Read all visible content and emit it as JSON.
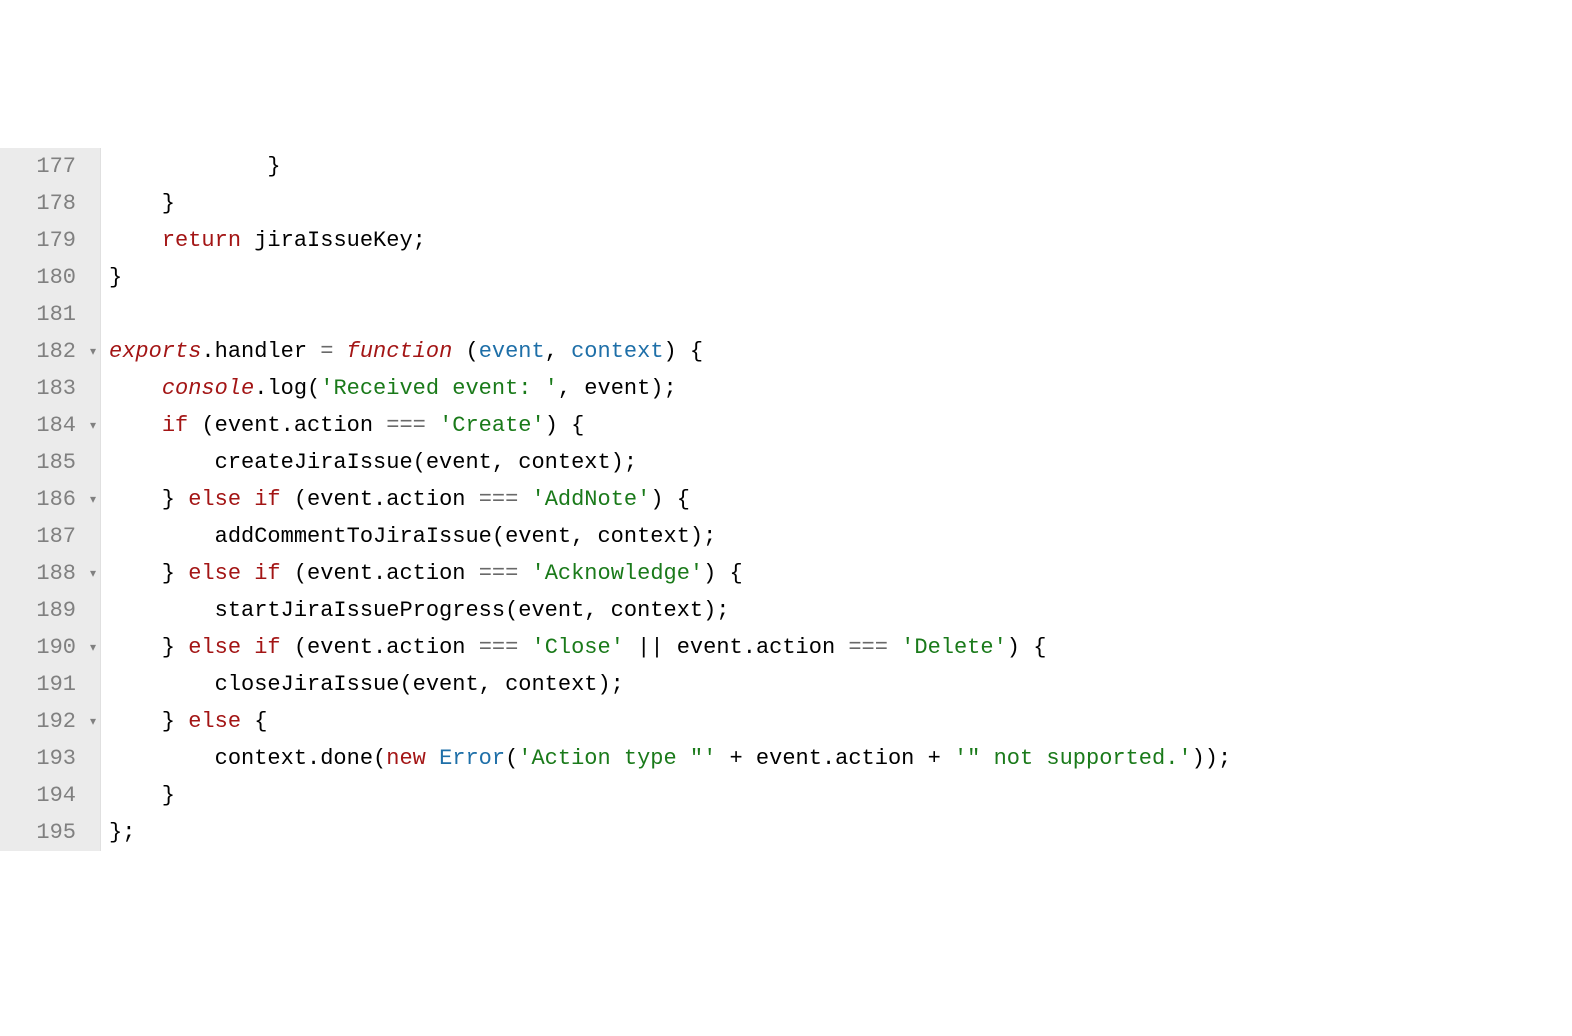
{
  "lines": [
    {
      "num": "177",
      "fold": false,
      "tokens": [
        {
          "cls": "ident",
          "t": "            }"
        }
      ]
    },
    {
      "num": "178",
      "fold": false,
      "tokens": [
        {
          "cls": "ident",
          "t": "    }"
        }
      ]
    },
    {
      "num": "179",
      "fold": false,
      "tokens": [
        {
          "cls": "ident",
          "t": "    "
        },
        {
          "cls": "kw-return",
          "t": "return"
        },
        {
          "cls": "ident",
          "t": " jiraIssueKey;"
        }
      ]
    },
    {
      "num": "180",
      "fold": false,
      "tokens": [
        {
          "cls": "ident",
          "t": "}"
        }
      ]
    },
    {
      "num": "181",
      "fold": false,
      "tokens": []
    },
    {
      "num": "182",
      "fold": true,
      "tokens": [
        {
          "cls": "kw-exports",
          "t": "exports"
        },
        {
          "cls": "ident",
          "t": ".handler "
        },
        {
          "cls": "op",
          "t": "="
        },
        {
          "cls": "ident",
          "t": " "
        },
        {
          "cls": "kw-function",
          "t": "function"
        },
        {
          "cls": "ident",
          "t": " ("
        },
        {
          "cls": "param",
          "t": "event"
        },
        {
          "cls": "ident",
          "t": ", "
        },
        {
          "cls": "param",
          "t": "context"
        },
        {
          "cls": "ident",
          "t": ") {"
        }
      ]
    },
    {
      "num": "183",
      "fold": false,
      "tokens": [
        {
          "cls": "ident",
          "t": "    "
        },
        {
          "cls": "console",
          "t": "console"
        },
        {
          "cls": "ident",
          "t": ".log("
        },
        {
          "cls": "str",
          "t": "'Received event: '"
        },
        {
          "cls": "ident",
          "t": ", event);"
        }
      ]
    },
    {
      "num": "184",
      "fold": true,
      "tokens": [
        {
          "cls": "ident",
          "t": "    "
        },
        {
          "cls": "kw-if",
          "t": "if"
        },
        {
          "cls": "ident",
          "t": " (event.action "
        },
        {
          "cls": "op",
          "t": "==="
        },
        {
          "cls": "ident",
          "t": " "
        },
        {
          "cls": "str",
          "t": "'Create'"
        },
        {
          "cls": "ident",
          "t": ") {"
        }
      ]
    },
    {
      "num": "185",
      "fold": false,
      "tokens": [
        {
          "cls": "ident",
          "t": "        createJiraIssue(event, context);"
        }
      ]
    },
    {
      "num": "186",
      "fold": true,
      "tokens": [
        {
          "cls": "ident",
          "t": "    } "
        },
        {
          "cls": "kw-else",
          "t": "else"
        },
        {
          "cls": "ident",
          "t": " "
        },
        {
          "cls": "kw-if",
          "t": "if"
        },
        {
          "cls": "ident",
          "t": " (event.action "
        },
        {
          "cls": "op",
          "t": "==="
        },
        {
          "cls": "ident",
          "t": " "
        },
        {
          "cls": "str",
          "t": "'AddNote'"
        },
        {
          "cls": "ident",
          "t": ") {"
        }
      ]
    },
    {
      "num": "187",
      "fold": false,
      "tokens": [
        {
          "cls": "ident",
          "t": "        addCommentToJiraIssue(event, context);"
        }
      ]
    },
    {
      "num": "188",
      "fold": true,
      "tokens": [
        {
          "cls": "ident",
          "t": "    } "
        },
        {
          "cls": "kw-else",
          "t": "else"
        },
        {
          "cls": "ident",
          "t": " "
        },
        {
          "cls": "kw-if",
          "t": "if"
        },
        {
          "cls": "ident",
          "t": " (event.action "
        },
        {
          "cls": "op",
          "t": "==="
        },
        {
          "cls": "ident",
          "t": " "
        },
        {
          "cls": "str",
          "t": "'Acknowledge'"
        },
        {
          "cls": "ident",
          "t": ") {"
        }
      ]
    },
    {
      "num": "189",
      "fold": false,
      "tokens": [
        {
          "cls": "ident",
          "t": "        startJiraIssueProgress(event, context);"
        }
      ]
    },
    {
      "num": "190",
      "fold": true,
      "tokens": [
        {
          "cls": "ident",
          "t": "    } "
        },
        {
          "cls": "kw-else",
          "t": "else"
        },
        {
          "cls": "ident",
          "t": " "
        },
        {
          "cls": "kw-if",
          "t": "if"
        },
        {
          "cls": "ident",
          "t": " (event.action "
        },
        {
          "cls": "op",
          "t": "==="
        },
        {
          "cls": "ident",
          "t": " "
        },
        {
          "cls": "str",
          "t": "'Close'"
        },
        {
          "cls": "ident",
          "t": " || event.action "
        },
        {
          "cls": "op",
          "t": "==="
        },
        {
          "cls": "ident",
          "t": " "
        },
        {
          "cls": "str",
          "t": "'Delete'"
        },
        {
          "cls": "ident",
          "t": ") {"
        }
      ]
    },
    {
      "num": "191",
      "fold": false,
      "tokens": [
        {
          "cls": "ident",
          "t": "        closeJiraIssue(event, context);"
        }
      ]
    },
    {
      "num": "192",
      "fold": true,
      "tokens": [
        {
          "cls": "ident",
          "t": "    } "
        },
        {
          "cls": "kw-else",
          "t": "else"
        },
        {
          "cls": "ident",
          "t": " {"
        }
      ]
    },
    {
      "num": "193",
      "fold": false,
      "tokens": [
        {
          "cls": "ident",
          "t": "        context.done("
        },
        {
          "cls": "kw-new",
          "t": "new"
        },
        {
          "cls": "ident",
          "t": " "
        },
        {
          "cls": "err-type",
          "t": "Error"
        },
        {
          "cls": "ident",
          "t": "("
        },
        {
          "cls": "str",
          "t": "'Action type \"'"
        },
        {
          "cls": "ident",
          "t": " + event.action + "
        },
        {
          "cls": "str",
          "t": "'\" not supported.'"
        },
        {
          "cls": "ident",
          "t": "));"
        }
      ]
    },
    {
      "num": "194",
      "fold": false,
      "tokens": [
        {
          "cls": "ident",
          "t": "    }"
        }
      ]
    },
    {
      "num": "195",
      "fold": false,
      "tokens": [
        {
          "cls": "ident",
          "t": "};"
        }
      ]
    }
  ]
}
